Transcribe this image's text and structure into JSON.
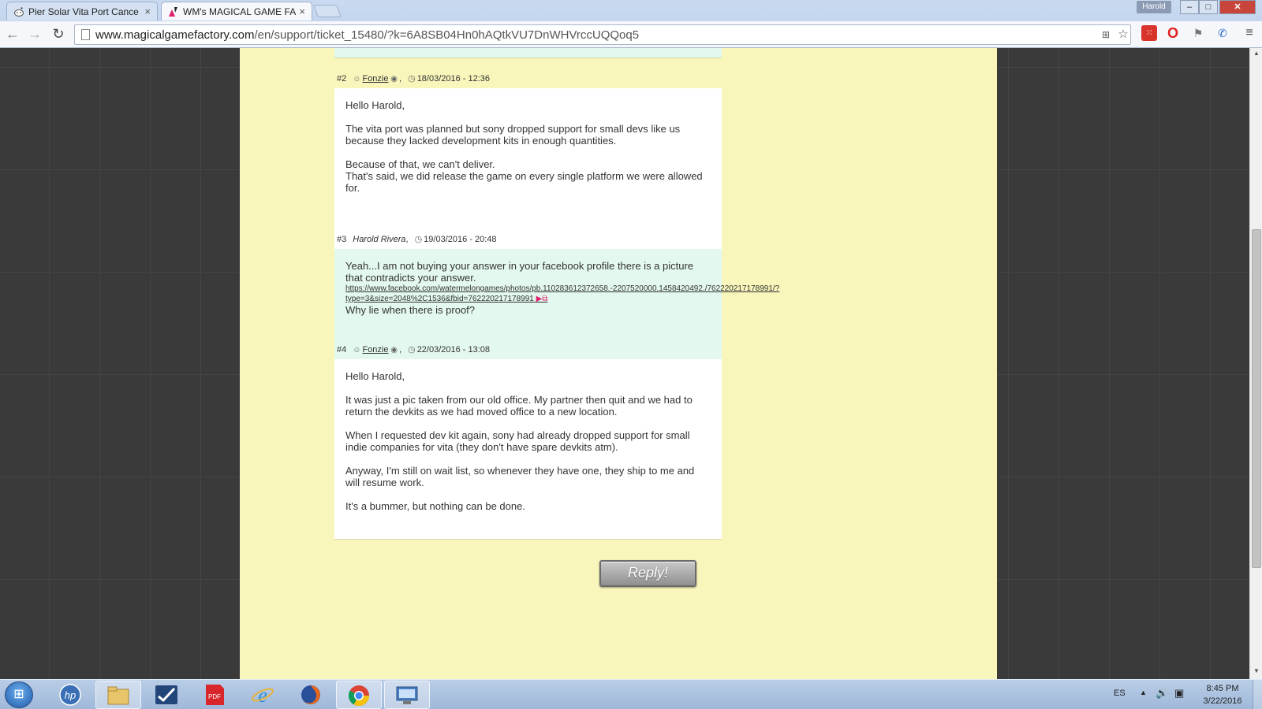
{
  "browser": {
    "tabs": [
      {
        "title": "Pier Solar Vita Port Cance",
        "close": "×",
        "active": false
      },
      {
        "title": "WM's MAGICAL GAME FA",
        "close": "×",
        "active": true
      }
    ],
    "profile_name": "Harold",
    "window_controls": {
      "minimize": "–",
      "maximize": "□",
      "close": "✕"
    },
    "url_host": "www.magicalgamefactory.com",
    "url_path": "/en/support/ticket_15480/?k=6A8SB04Hn0hAQtkVU7DnWHVrccUQQoq5"
  },
  "ticket": {
    "messages": [
      {
        "number": "#2",
        "author": "Fonzie",
        "author_is_link": true,
        "datetime": "18/03/2016 - 12:36",
        "paragraphs": [
          "Hello Harold,",
          "The vita port was planned but sony dropped support for small devs like us because they lacked development kits in enough quantities.",
          "Because of that, we can't deliver.\nThat's said, we did release the game on every single platform we were allowed for."
        ]
      },
      {
        "number": "#3",
        "author": "Harold Rivera",
        "author_is_link": false,
        "datetime": "19/03/2016 - 20:48",
        "text_before_link": "Yeah...I am not buying your answer in your facebook profile there is a picture that contradicts your answer.",
        "link": "https://www.facebook.com/watermelongames/photos/pb.110283612372658.-2207520000.1458420492./762220217178991/?type=3&size=2048%2C1536&fbid=762220217178991",
        "text_after_link": "Why lie when there is proof?"
      },
      {
        "number": "#4",
        "author": "Fonzie",
        "author_is_link": true,
        "datetime": "22/03/2016 - 13:08",
        "paragraphs": [
          "Hello Harold,",
          "It was just a pic taken from our old office. My partner then quit and we had to return the devkits as we had moved office to a new location.",
          "When I requested dev kit again, sony had already dropped support for small indie companies for vita (they don't have spare devkits atm).",
          "Anyway, I'm still on wait list, so whenever they have one, they ship to me and will resume work.",
          "It's a bummer, but nothing can be done."
        ]
      }
    ],
    "reply_label": "Reply!"
  },
  "taskbar": {
    "items": [
      "hp-icon",
      "file-explorer-icon",
      "task-manager-icon",
      "pdf-icon",
      "internet-explorer-icon",
      "firefox-icon",
      "chrome-icon",
      "remote-desktop-icon"
    ],
    "language": "ES",
    "time": "8:45 PM",
    "date": "3/22/2016"
  },
  "colors": {
    "page_panel": "#f8f6bb",
    "staff_message_bg": "#ffffff",
    "user_message_bg": "#e3f8ee",
    "reply_button": "#a8a8a8"
  }
}
